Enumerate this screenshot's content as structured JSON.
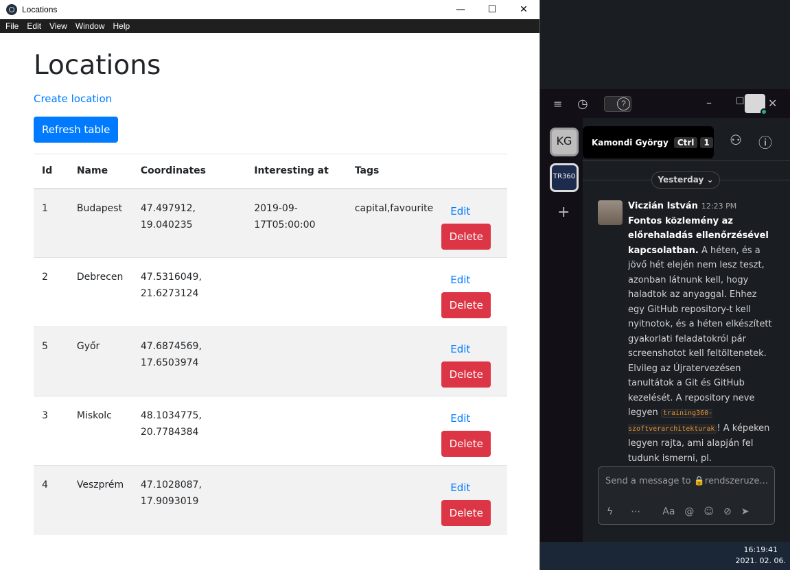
{
  "window": {
    "title": "Locations",
    "controls": {
      "minimize": "—",
      "maximize": "☐",
      "close": "✕"
    }
  },
  "menu": [
    "File",
    "Edit",
    "View",
    "Window",
    "Help"
  ],
  "page": {
    "heading": "Locations",
    "create_link": "Create location",
    "refresh_button": "Refresh table"
  },
  "table": {
    "headers": [
      "Id",
      "Name",
      "Coordinates",
      "Interesting at",
      "Tags"
    ],
    "rows": [
      {
        "id": "1",
        "name": "Budapest",
        "coord_lat": "47.497912,",
        "coord_lon": "19.040235",
        "interesting_a": "2019-09-",
        "interesting_b": "17T05:00:00",
        "tags": "capital,favourite"
      },
      {
        "id": "2",
        "name": "Debrecen",
        "coord_lat": "47.5316049,",
        "coord_lon": "21.6273124",
        "interesting_a": "",
        "interesting_b": "",
        "tags": ""
      },
      {
        "id": "5",
        "name": "Győr",
        "coord_lat": "47.6874569,",
        "coord_lon": "17.6503974",
        "interesting_a": "",
        "interesting_b": "",
        "tags": ""
      },
      {
        "id": "3",
        "name": "Miskolc",
        "coord_lat": "48.1034775,",
        "coord_lon": "20.7784384",
        "interesting_a": "",
        "interesting_b": "",
        "tags": ""
      },
      {
        "id": "4",
        "name": "Veszprém",
        "coord_lat": "47.1028087,",
        "coord_lon": "17.9093019",
        "interesting_a": "",
        "interesting_b": "",
        "tags": ""
      }
    ],
    "edit_label": "Edit",
    "delete_label": "Delete"
  },
  "slack": {
    "workspace_1": "KG",
    "workspace_2": "TR360",
    "tooltip_name": "Kamondi György",
    "tooltip_key1": "Ctrl",
    "tooltip_key2": "1",
    "day_divider": "Yesterday ⌄",
    "message": {
      "author": "Viczián István",
      "time": "12:23 PM",
      "bold_text": "Fontos közlemény az előrehaladás ellenőrzésével kapcsolatban.",
      "text_1": " A héten, és a jövő hét elején nem lesz teszt, azonban látnunk kell, hogy haladtok az anyaggal. Ehhez egy GitHub repository-t kell nyitnotok, és a héten elkészített gyakorlati feladatokról pár screenshotot kell feltöltenetek. Elvileg az Újratervezésen tanultátok a Git és GitHub kezelését. A repository neve legyen ",
      "code": "training360-szoftverarchitekturak",
      "text_2": "! A képeken legyen rajta, ami alapján fel tudunk ismerni, pl."
    },
    "composer_placeholder": "Send a message to 🔒rendszeruze...",
    "composer_tools": [
      "ϟ",
      "⋯",
      "Aa",
      "@",
      "☺",
      "⊘",
      "➤"
    ]
  },
  "taskbar": {
    "time": "16:19:41",
    "date": "2021. 02. 06."
  }
}
